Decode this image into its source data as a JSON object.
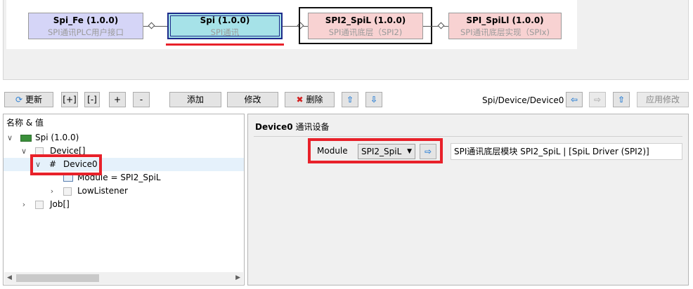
{
  "modules": [
    {
      "title": "Spi_Fe (1.0.0)",
      "subtitle": "SPI通讯PLC用户接口"
    },
    {
      "title": "Spi (1.0.0)",
      "subtitle": "SPI通讯"
    },
    {
      "title": "SPI2_SpiL (1.0.0)",
      "subtitle": "SPI通讯底层（SPI2)"
    },
    {
      "title": "SPI_SpiLl (1.0.0)",
      "subtitle": "SPI通讯底层实现（SPIx)"
    }
  ],
  "toolbar": {
    "refresh_label": "更新",
    "expand_label": "[+]",
    "collapse_label": "[-]",
    "plus_label": "+",
    "minus_label": "-",
    "add_label": "添加",
    "edit_label": "修改",
    "delete_label": "删除",
    "up_icon": "up-arrow-icon",
    "down_icon": "down-arrow-icon",
    "path": "Spi/Device/Device0",
    "apply_label": "应用修改"
  },
  "tree": {
    "header": "名称 & 值",
    "items": [
      {
        "label": "Spi (1.0.0)"
      },
      {
        "label": "Device[]"
      },
      {
        "label": "Device0",
        "prefix": "#"
      },
      {
        "label": "Module = SPI2_SpiL"
      },
      {
        "label": "LowListener"
      },
      {
        "label": "Job[]"
      }
    ]
  },
  "detail": {
    "title_bold": "Device0",
    "title_rest": " 通讯设备",
    "module_label": "Module",
    "module_value": "SPI2_SpiL",
    "module_desc": "SPI通讯底层模块 SPI2_SpiL | [SpiL Driver (SPI2)]"
  },
  "colors": {
    "accent_red": "#e8212a",
    "selected_module": "#a6e2e8",
    "arrow_blue": "#2b7fd4"
  }
}
